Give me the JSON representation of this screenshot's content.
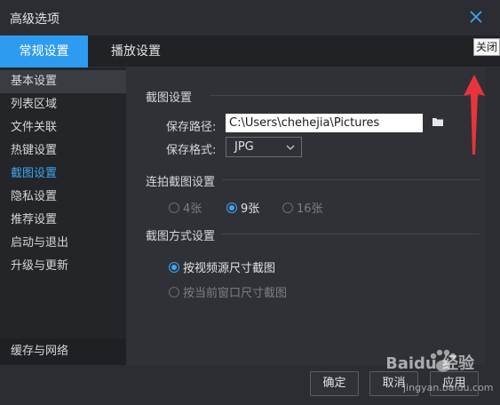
{
  "window": {
    "title": "高级选项",
    "close_tooltip": "关闭"
  },
  "tabs": [
    {
      "label": "常规设置",
      "active": true
    },
    {
      "label": "播放设置",
      "active": false
    }
  ],
  "sidebar": {
    "items": [
      {
        "label": "基本设置"
      },
      {
        "label": "列表区域"
      },
      {
        "label": "文件关联"
      },
      {
        "label": "热键设置"
      },
      {
        "label": "截图设置"
      },
      {
        "label": "隐私设置"
      },
      {
        "label": "推荐设置"
      },
      {
        "label": "启动与退出"
      },
      {
        "label": "升级与更新"
      }
    ],
    "bottom_item": "缓存与网络"
  },
  "screenshot": {
    "section_title": "截图设置",
    "path_label": "保存路径:",
    "path_value": "C:\\Users\\chehejia\\Pictures",
    "format_label": "保存格式:",
    "format_value": "JPG"
  },
  "burst": {
    "section_title": "连拍截图设置",
    "options": [
      {
        "label": "4张",
        "checked": false
      },
      {
        "label": "9张",
        "checked": true
      },
      {
        "label": "16张",
        "checked": false
      }
    ]
  },
  "mode": {
    "section_title": "截图方式设置",
    "options": [
      {
        "label": "按视频源尺寸截图",
        "checked": true
      },
      {
        "label": "按当前窗口尺寸截图",
        "checked": false
      }
    ]
  },
  "footer": {
    "ok": "确定",
    "cancel": "取消",
    "apply": "应用"
  },
  "watermark": {
    "text": "Baidu 经验",
    "url": "jingyan.baidu.com"
  },
  "colors": {
    "accent": "#2d9cf0",
    "annotation_arrow": "#e8343a"
  },
  "icons": {
    "close": "close-icon",
    "folder": "folder-icon",
    "chevron": "chevron-down-icon",
    "paw": "paw-icon"
  }
}
